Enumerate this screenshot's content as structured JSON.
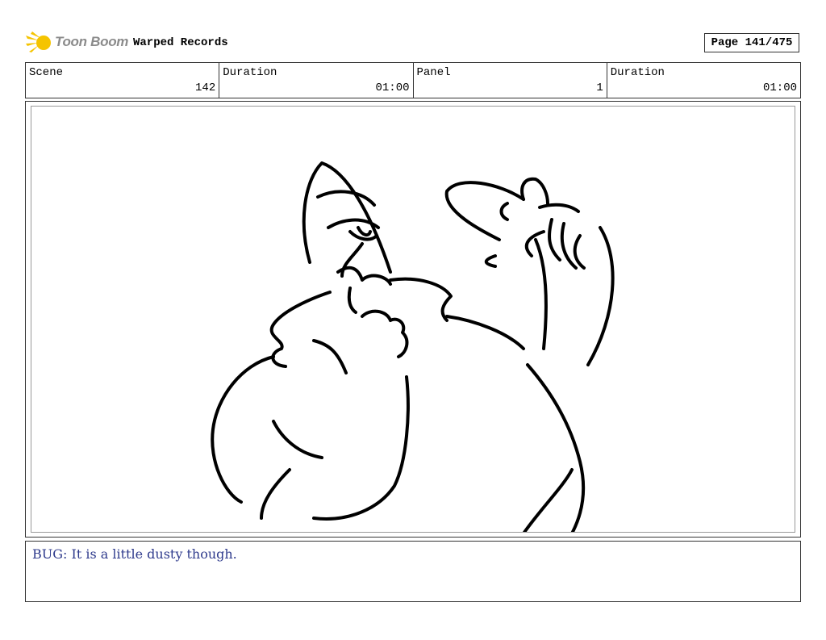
{
  "header": {
    "logo_text": "Toon Boom",
    "project": "Warped Records",
    "page": "Page 141/475"
  },
  "info": {
    "scene_label": "Scene",
    "scene_value": "142",
    "scene_duration_label": "Duration",
    "scene_duration_value": "01:00",
    "panel_label": "Panel",
    "panel_value": "1",
    "panel_duration_label": "Duration",
    "panel_duration_value": "01:00"
  },
  "notes": {
    "dialogue": "BUG: It is a little dusty though."
  },
  "colors": {
    "logo_yellow": "#f5c400",
    "logo_text": "#8b8b8b",
    "notes_text": "#2e3a8c"
  }
}
